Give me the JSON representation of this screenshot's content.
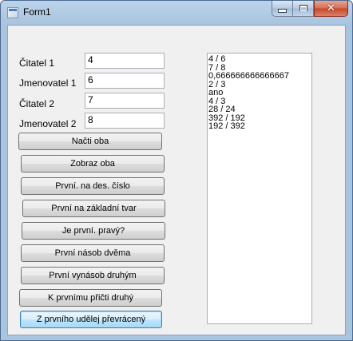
{
  "window": {
    "title": "Form1",
    "close_glyph": "✕"
  },
  "labels": [
    {
      "text": "Čitatel 1",
      "value": "4"
    },
    {
      "text": "Jmenovatel 1",
      "value": "6"
    },
    {
      "text": "Čitatel 2",
      "value": "7"
    },
    {
      "text": "Jmenovatel 2",
      "value": "8"
    }
  ],
  "buttons": [
    "Načti oba",
    "Zobraz oba",
    "První. na des. číslo",
    "První na základní tvar",
    "Je první. pravý?",
    "První násob dvěma",
    "První vynásob druhým",
    "K prvnímu přičti druhý",
    "Z prvního udělej převrácený"
  ],
  "output": [
    "4 / 6",
    "7 / 8",
    "0,666666666666667",
    "2 / 3",
    "ano",
    "4 / 3",
    "28 / 24",
    "392 / 192",
    "192 / 392"
  ],
  "colors": {
    "titlebar": "#a9c4df",
    "client": "#f0f0f0",
    "close": "#c3472c"
  },
  "icons": {
    "app": "form-app-icon",
    "minimize": "minimize-icon",
    "maximize": "maximize-icon",
    "close": "close-icon"
  }
}
